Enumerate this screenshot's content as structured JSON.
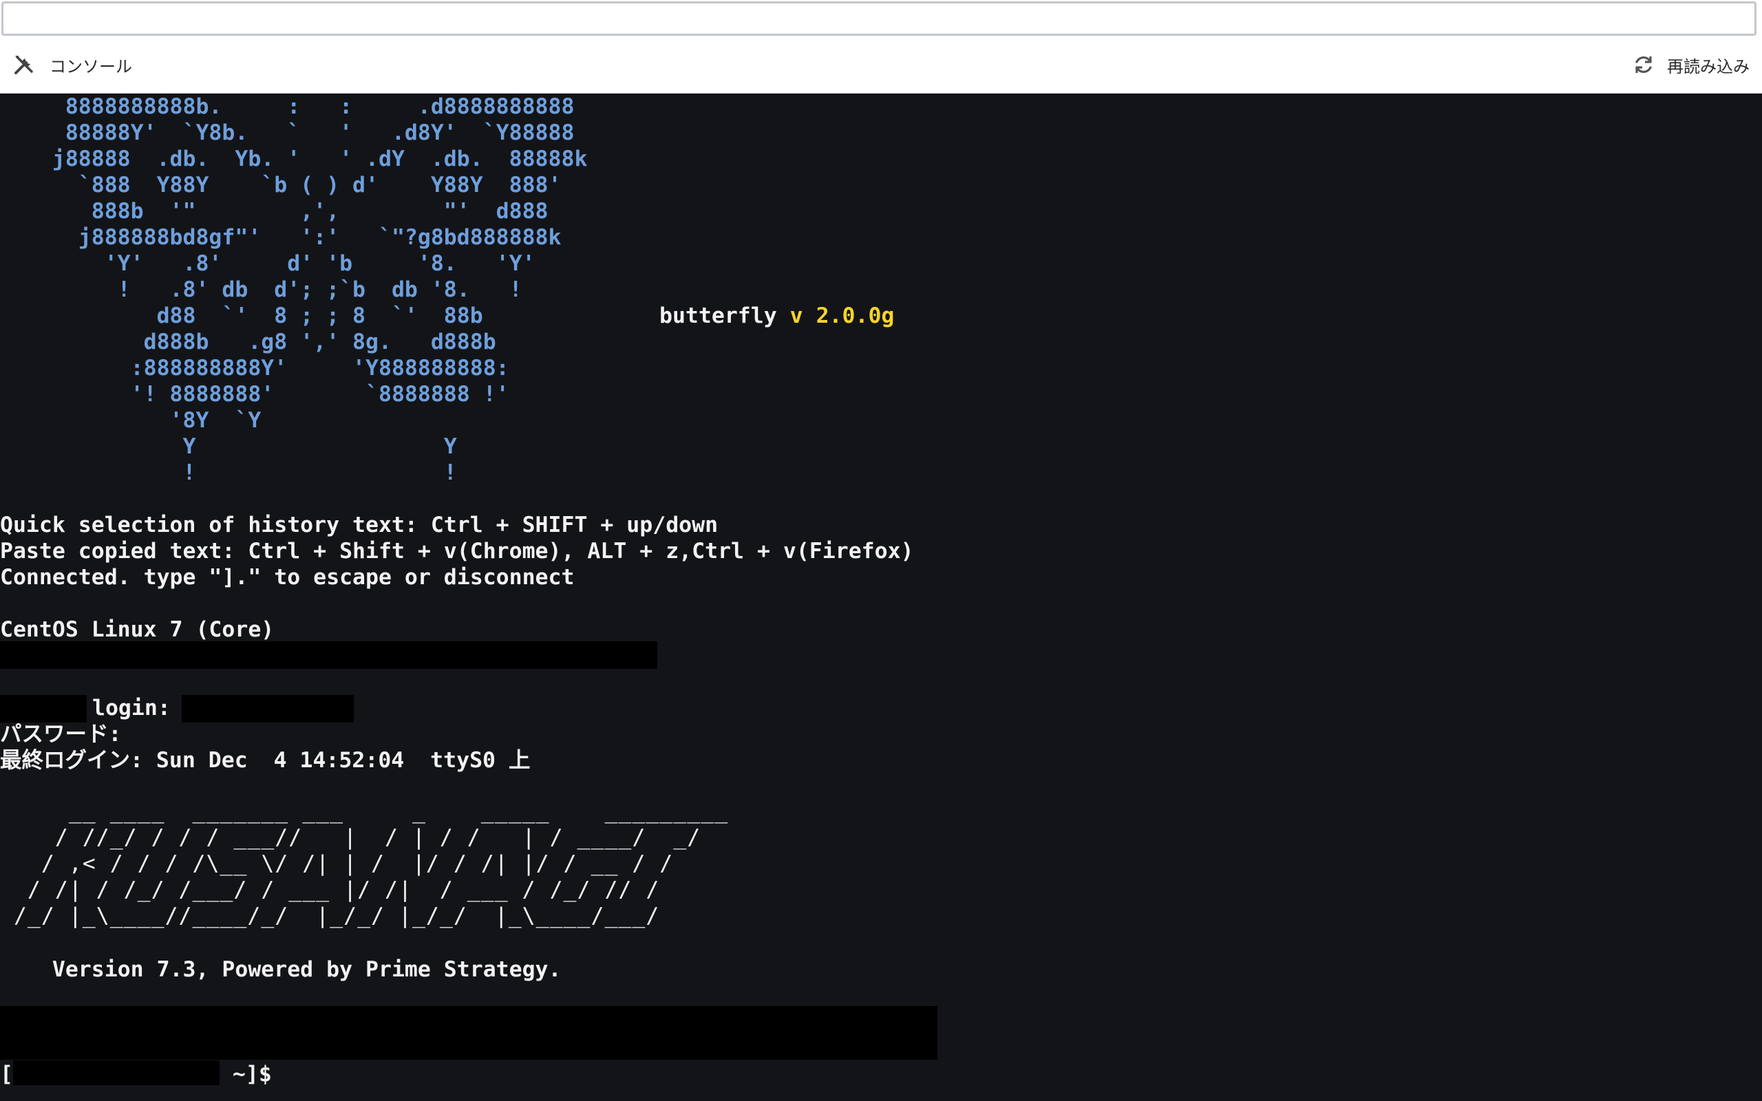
{
  "toolbar": {
    "console_label": "コンソール",
    "reload_label": "再読み込み",
    "console_icon": "tools-icon",
    "reload_icon": "reload-icon"
  },
  "terminal": {
    "butterfly_art": [
      "     8888888888b.     :   :     .d8888888888",
      "     88888Y'  `Y8b.   `   '   .d8Y'  `Y88888",
      "    j88888  .db.  Yb. '   ' .dY  .db.  88888k",
      "      `888  Y88Y    `b ( ) d'    Y88Y  888'",
      "       888b  '\"        ,',        \"'  d888",
      "      j888888bd8gf\"'   ':'   `\"?g8bd888888k",
      "        'Y'   .8'     d' 'b     '8.   'Y'",
      "         !   .8' db  d'; ;`b  db '8.   !",
      "            d88  `'  8 ; ; 8  `'  88b",
      "           d888b   .g8 ',' 8g.   d888b",
      "          :888888888Y'     'Y888888888:",
      "          '! 8888888'       `8888888 !'",
      "             '8Y  `Y",
      "              Y                   Y",
      "              !                   !"
    ],
    "version_name": "butterfly",
    "version_number": "v 2.0.0g",
    "help_lines": [
      "Quick selection of history text: Ctrl + SHIFT + up/down",
      "Paste copied text: Ctrl + Shift + v(Chrome), ALT + z,Ctrl + v(Firefox)",
      "Connected. type \"].\" to escape or disconnect"
    ],
    "os_line": "CentOS Linux 7 (Core)",
    "login_label": "login:",
    "password_label": "パスワード:",
    "last_login": "最終ログイン: Sun Dec  4 14:52:04  ttyS0 上",
    "kusanagi_art": [
      "     __ ____  _______ ___     _    _____    _________",
      "    / //_/ / / / ___//   |  / | / /   | / ____/  _/",
      "   / ,< / / / /\\__ \\/ /| | /  |/ / /| |/ / __ / /",
      "  / /| / /_/ /___/ / ___ |/ /|  / ___ / /_/ // /",
      " /_/ |_\\____//____/_/  |_/_/ |_/_/  |_\\____/___/"
    ],
    "powered_by": "    Version 7.3, Powered by Prime Strategy.",
    "prompt_open": "[",
    "prompt_close": " ~]$"
  }
}
